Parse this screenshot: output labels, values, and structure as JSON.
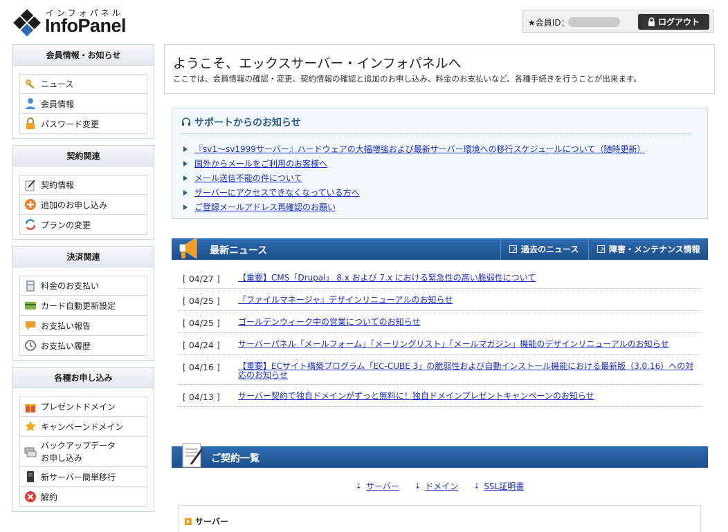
{
  "header": {
    "logo_sub": "インフォパネル",
    "logo_main": "InfoPanel",
    "member_label": "★会員ID：",
    "logout_label": "ログアウト"
  },
  "sidebar": [
    {
      "title": "会員情報・お知らせ",
      "items": [
        {
          "label": "ニュース",
          "icon": "key-icon"
        },
        {
          "label": "会員情報",
          "icon": "user-icon"
        },
        {
          "label": "パスワード変更",
          "icon": "lock-icon"
        }
      ]
    },
    {
      "title": "契約関連",
      "items": [
        {
          "label": "契約情報",
          "icon": "contract-icon"
        },
        {
          "label": "追加のお申し込み",
          "icon": "add-icon"
        },
        {
          "label": "プランの変更",
          "icon": "change-icon"
        }
      ]
    },
    {
      "title": "決済関連",
      "items": [
        {
          "label": "料金のお支払い",
          "icon": "calculator-icon"
        },
        {
          "label": "カード自動更新設定",
          "icon": "card-icon"
        },
        {
          "label": "お支払い報告",
          "icon": "report-icon"
        },
        {
          "label": "お支払い履歴",
          "icon": "clock-icon"
        }
      ]
    },
    {
      "title": "各種お申し込み",
      "items": [
        {
          "label": "プレゼントドメイン",
          "icon": "gift-icon"
        },
        {
          "label": "キャンペーンドメイン",
          "icon": "star-icon"
        },
        {
          "label": "バックアップデータ\nお申し込み",
          "icon": "backup-icon"
        },
        {
          "label": "新サーバー簡単移行",
          "icon": "server-icon"
        },
        {
          "label": "解約",
          "icon": "cancel-icon"
        }
      ]
    }
  ],
  "welcome": {
    "title": "ようこそ、エックスサーバー・インフォパネルへ",
    "desc": "ここでは、会員情報の確認・変更、契約情報の確認と追加のお申し込み、料金のお支払いなど、各種手続きを行うことが出来ます。"
  },
  "support": {
    "title": "サポートからのお知らせ",
    "items": [
      "『sv1～sv1999サーバー』ハードウェアの大幅増強および最新サーバー環境への移行スケジュールについて（随時更新）",
      "国外からメールをご利用のお客様へ",
      "メール送信不能の件について",
      "サーバーにアクセスできなくなっている方へ",
      "ご登録メールアドレス再確認のお願い"
    ]
  },
  "news": {
    "title": "最新ニュース",
    "tab_past": "過去のニュース",
    "tab_maint": "障害・メンテナンス情報",
    "items": [
      {
        "date": "[ 04/27 ]",
        "text": "【重要】CMS「Drupal」 8.x および 7.x における緊急性の高い脆弱性について"
      },
      {
        "date": "[ 04/25 ]",
        "text": "『ファイルマネージャ』デザインリニューアルのお知らせ"
      },
      {
        "date": "[ 04/25 ]",
        "text": "ゴールデンウィーク中の営業についてのお知らせ"
      },
      {
        "date": "[ 04/24 ]",
        "text": "サーバーパネル「メールフォーム」「メーリングリスト」「メールマガジン」機能のデザインリニューアルのお知らせ"
      },
      {
        "date": "[ 04/16 ]",
        "text": "【重要】ECサイト構築プログラム「EC-CUBE 3」の脆弱性および自動インストール機能における最新版（3.0.16）への対応のお知らせ"
      },
      {
        "date": "[ 04/13 ]",
        "text": "サーバー契約で独自ドメインがずっと無料に！独自ドメインプレゼントキャンペーンのお知らせ"
      }
    ]
  },
  "contracts": {
    "title": "ご契約一覧",
    "anchors": [
      "サーバー",
      "ドメイン",
      "SSL証明書"
    ],
    "server_title": "サーバー"
  },
  "colors": {
    "accent": "#1b4e8c",
    "link": "#1a2fc7"
  }
}
